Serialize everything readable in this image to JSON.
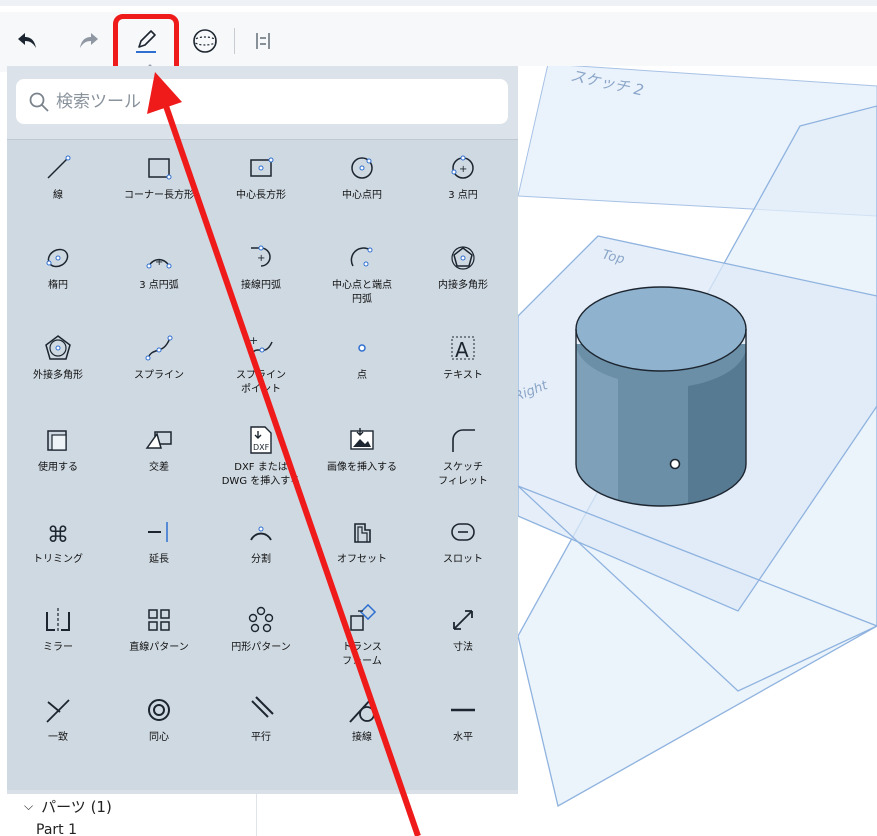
{
  "search": {
    "placeholder": "検索ツール"
  },
  "toolbar": {
    "undo_icon": "undo-icon",
    "redo_icon": "redo-icon",
    "sketch_icon": "pencil-icon",
    "view_icon": "sphere-icon",
    "tools_icon": "sliders-icon",
    "highlight_color": "#ef1b1b"
  },
  "tools": [
    {
      "label": "線",
      "icon": "line-icon"
    },
    {
      "label": "コーナー長方形",
      "icon": "corner-rectangle-icon"
    },
    {
      "label": "中心長方形",
      "icon": "center-rectangle-icon"
    },
    {
      "label": "中心点円",
      "icon": "center-circle-icon"
    },
    {
      "label": "3 点円",
      "icon": "three-point-circle-icon"
    },
    {
      "label": "楕円",
      "icon": "ellipse-icon"
    },
    {
      "label": "3 点円弧",
      "icon": "three-point-arc-icon"
    },
    {
      "label": "接線円弧",
      "icon": "tangent-arc-icon"
    },
    {
      "label": "中心点と端点\n円弧",
      "icon": "center-arc-icon"
    },
    {
      "label": "内接多角形",
      "icon": "inscribed-polygon-icon"
    },
    {
      "label": "外接多角形",
      "icon": "circumscribed-polygon-icon"
    },
    {
      "label": "スプライン",
      "icon": "spline-icon"
    },
    {
      "label": "スプライン\nポイント",
      "icon": "spline-points-icon"
    },
    {
      "label": "点",
      "icon": "point-icon"
    },
    {
      "label": "テキスト",
      "icon": "text-icon"
    },
    {
      "label": "使用する",
      "icon": "use-icon"
    },
    {
      "label": "交差",
      "icon": "intersection-icon"
    },
    {
      "label": "DXF または\nDWG を挿入する",
      "icon": "dxf-icon"
    },
    {
      "label": "画像を挿入する",
      "icon": "insert-image-icon"
    },
    {
      "label": "スケッチ\nフィレット",
      "icon": "sketch-fillet-icon"
    },
    {
      "label": "トリミング",
      "icon": "trim-icon"
    },
    {
      "label": "延長",
      "icon": "extend-icon"
    },
    {
      "label": "分割",
      "icon": "split-icon"
    },
    {
      "label": "オフセット",
      "icon": "offset-icon"
    },
    {
      "label": "スロット",
      "icon": "slot-icon"
    },
    {
      "label": "ミラー",
      "icon": "mirror-icon"
    },
    {
      "label": "直線パターン",
      "icon": "linear-pattern-icon"
    },
    {
      "label": "円形パターン",
      "icon": "circular-pattern-icon"
    },
    {
      "label": "トランス\nフォーム",
      "icon": "transform-icon"
    },
    {
      "label": "寸法",
      "icon": "dimension-icon"
    },
    {
      "label": "一致",
      "icon": "coincident-icon"
    },
    {
      "label": "同心",
      "icon": "concentric-icon"
    },
    {
      "label": "平行",
      "icon": "parallel-icon"
    },
    {
      "label": "接線",
      "icon": "tangent-icon"
    },
    {
      "label": "水平",
      "icon": "horizontal-icon"
    }
  ],
  "tree": {
    "parts_label": "パーツ (1)",
    "part_item": "Part 1"
  },
  "canvas": {
    "plane_sketch2": "スケッチ 2",
    "plane_top": "Top",
    "plane_right": "Right",
    "plane_color": "#8fb3df",
    "cylinder_color": "#6f93ad"
  }
}
